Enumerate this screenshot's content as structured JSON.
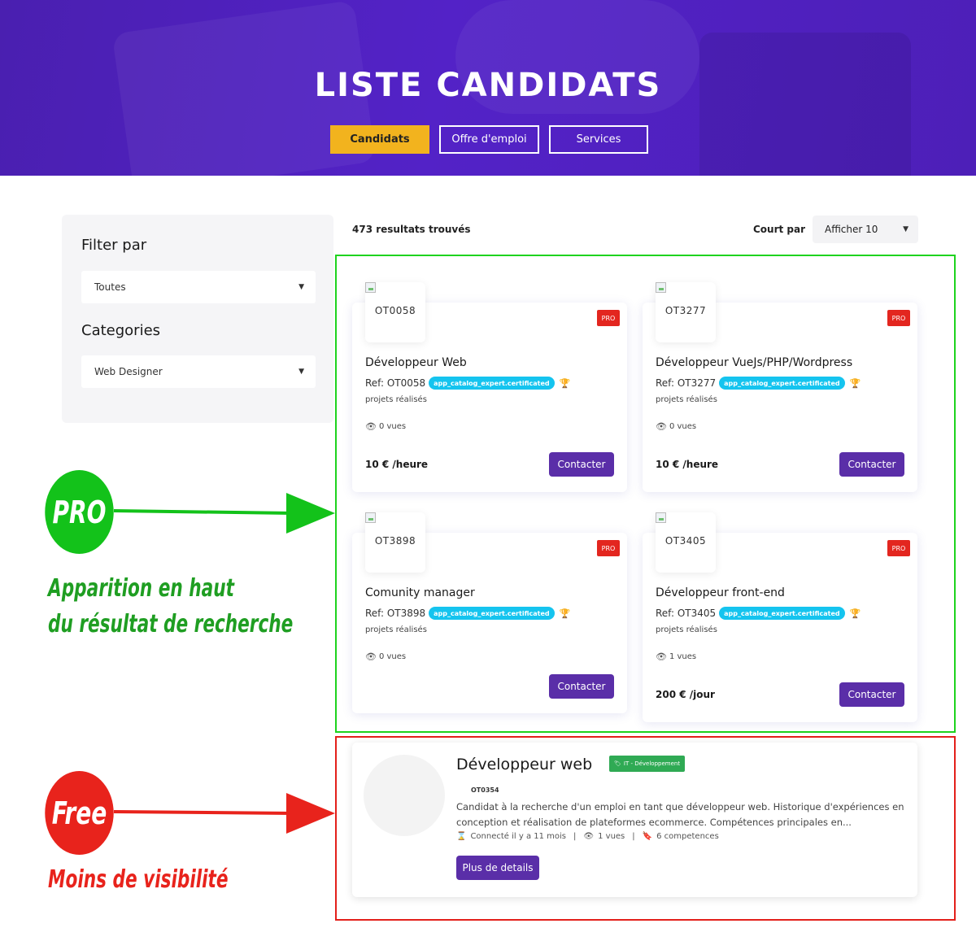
{
  "hero": {
    "title": "LISTE CANDIDATS",
    "tabs": [
      {
        "label": "Candidats",
        "active": true
      },
      {
        "label": "Offre d'emploi",
        "active": false
      },
      {
        "label": "Services",
        "active": false
      }
    ]
  },
  "filter": {
    "title": "Filter par",
    "type_value": "Toutes",
    "categories_title": "Categories",
    "category_value": "Web Designer"
  },
  "results": {
    "count_text": "473 resultats trouvés",
    "sort_label": "Court par",
    "sort_value": "Afficher 10"
  },
  "pro_cards": [
    {
      "code": "OT0058",
      "badge": "PRO",
      "title": "Développeur Web",
      "ref": "Ref: OT0058",
      "cert": "app_catalog_expert.certificated",
      "projects": "projets réalisés",
      "views": "0 vues",
      "price": "10 € /heure",
      "contact": "Contacter"
    },
    {
      "code": "OT3277",
      "badge": "PRO",
      "title": "Développeur VueJs/PHP/Wordpress",
      "ref": "Ref: OT3277",
      "cert": "app_catalog_expert.certificated",
      "projects": "projets réalisés",
      "views": "0 vues",
      "price": "10 € /heure",
      "contact": "Contacter"
    },
    {
      "code": "OT3898",
      "badge": "PRO",
      "title": "Comunity manager",
      "ref": "Ref: OT3898",
      "cert": "app_catalog_expert.certificated",
      "projects": "projets réalisés",
      "views": "0 vues",
      "price": "",
      "contact": "Contacter"
    },
    {
      "code": "OT3405",
      "badge": "PRO",
      "title": "Développeur front-end",
      "ref": "Ref: OT3405",
      "cert": "app_catalog_expert.certificated",
      "projects": "projets réalisés",
      "views": "1 vues",
      "price": "200 € /jour",
      "contact": "Contacter"
    }
  ],
  "free_card": {
    "title": "Développeur web",
    "category": "IT - Développement",
    "code": "OT0354",
    "description": "Candidat à la recherche d'un emploi en tant que développeur web. Historique d'expériences en conception et réalisation de plateformes ecommerce. Compétences principales en...",
    "connected": "Connecté il y a 11 mois",
    "views": "1 vues",
    "competences": "6 competences",
    "button": "Plus de details"
  },
  "annotations": {
    "pro_label": "PRO",
    "pro_text_line1": "Apparition en haut",
    "pro_text_line2": "du résultat de recherche",
    "free_label": "Free",
    "free_text": "Moins de visibilité",
    "green": "#13c21a",
    "red": "#e8231c",
    "green_text": "#1f9e22"
  },
  "colors": {
    "hero_purple": "#5322c7",
    "accent_yellow": "#f2b31e",
    "button_purple": "#5a2ea8",
    "cert_cyan": "#15c4ef",
    "pro_red": "#e3261f",
    "category_green": "#2faa54"
  }
}
